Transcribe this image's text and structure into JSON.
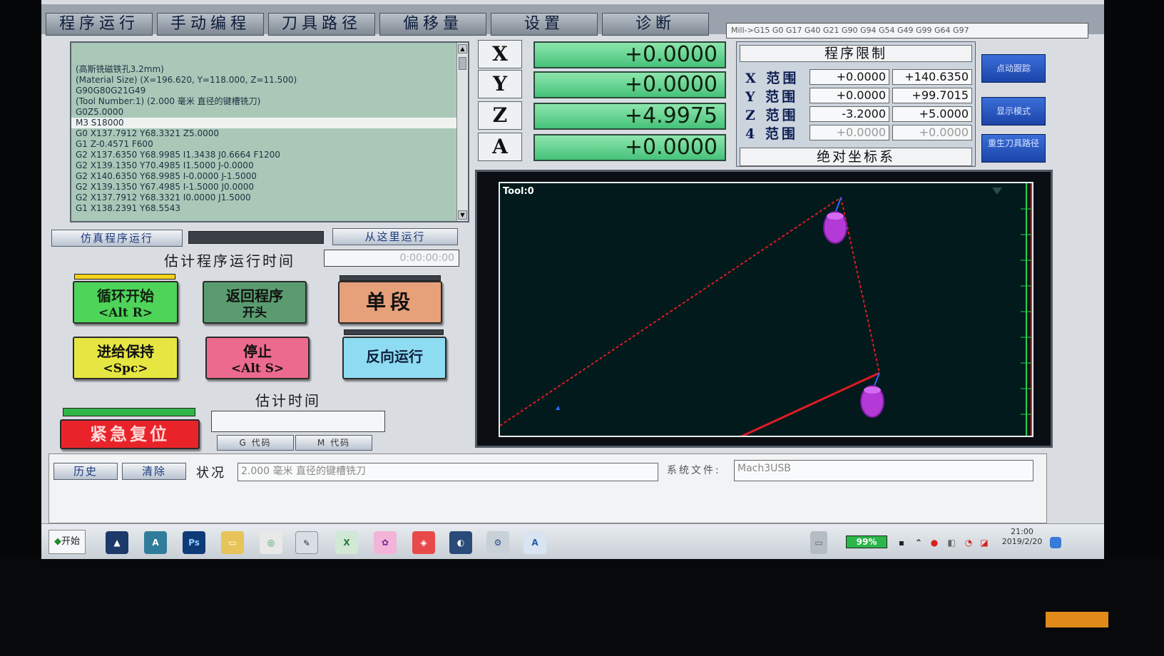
{
  "tabs": [
    "程序运行",
    "手动编程",
    "刀具路径",
    "偏移量",
    "设置",
    "诊断"
  ],
  "gcode_modal": "Mill->G15  G0 G17 G40 G21 G90 G94 G54 G49 G99 G64 G97",
  "code_lines": [
    "(高斯铣磁铁孔3.2mm)",
    "(Material Size) (X=196.620, Y=118.000, Z=11.500)",
    "G90G80G21G49",
    "(Tool Number:1) (2.000 毫米 直径的键槽铣刀)",
    "G0Z5.0000",
    "M3 S18000",
    "G0 X137.7912 Y68.3321 Z5.0000",
    "G1   Z-0.4571 F600",
    "G2 X137.6350 Y68.9985 I1.3438 J0.6664 F1200",
    "G2 X139.1350 Y70.4985 I1.5000 J-0.0000",
    "G2 X140.6350 Y68.9985 I-0.0000 J-1.5000",
    "G2 X139.1350 Y67.4985 I-1.5000 J0.0000",
    "G2 X137.7912 Y68.3321 I0.0000 J1.5000",
    "G1 X138.2391 Y68.5543"
  ],
  "highlight_line": 5,
  "sim_button": "仿真程序运行",
  "run_from_here": "从这里运行",
  "est_run_label": "估计程序运行时间",
  "est_run_value": "0:00:00:00",
  "buttons": {
    "cycle_start": "循环开始",
    "cycle_start_key": "<Alt R>",
    "rewind": "返回程序",
    "rewind2": "开头",
    "single": "单段",
    "feedhold": "进给保持",
    "feedhold_key": "<Spc>",
    "stop": "停止",
    "stop_key": "<Alt S>",
    "reverse": "反向运行"
  },
  "est_time_label": "估计时间",
  "reset": "紧急复位",
  "gcodes_btn": "G 代码",
  "mcodes_btn": "M 代码",
  "dro": [
    {
      "axis": "X",
      "value": "+0.0000"
    },
    {
      "axis": "Y",
      "value": "+0.0000"
    },
    {
      "axis": "Z",
      "value": "+4.9975"
    },
    {
      "axis": "A",
      "value": "+0.0000"
    }
  ],
  "limits": {
    "title": "程序限制",
    "rows": [
      {
        "label": "X 范围",
        "min": "+0.0000",
        "max": "+140.6350"
      },
      {
        "label": "Y 范围",
        "min": "+0.0000",
        "max": "+99.7015"
      },
      {
        "label": "Z 范围",
        "min": "-3.2000",
        "max": "+5.0000"
      },
      {
        "label": "4 范围",
        "min": "+0.0000",
        "max": "+0.0000"
      }
    ],
    "footer": "绝对坐标系"
  },
  "side_buttons": [
    "点动跟踪",
    "显示模式",
    "重生刀具路径"
  ],
  "tool_label": "Tool:0",
  "history": "历史",
  "clear": "清除",
  "status_label": "状况",
  "status_value": "2.000 毫米 直径的键槽铣刀",
  "sysfile_label": "系统文件:",
  "sysfile_value": "Mach3USB",
  "start": "开始",
  "battery": "99%",
  "clock_time": "21:00",
  "clock_date": "2019/2/20",
  "colors": {
    "path": "#e01b24",
    "tool": "#b43ad8",
    "dro": "#5ad68c"
  }
}
